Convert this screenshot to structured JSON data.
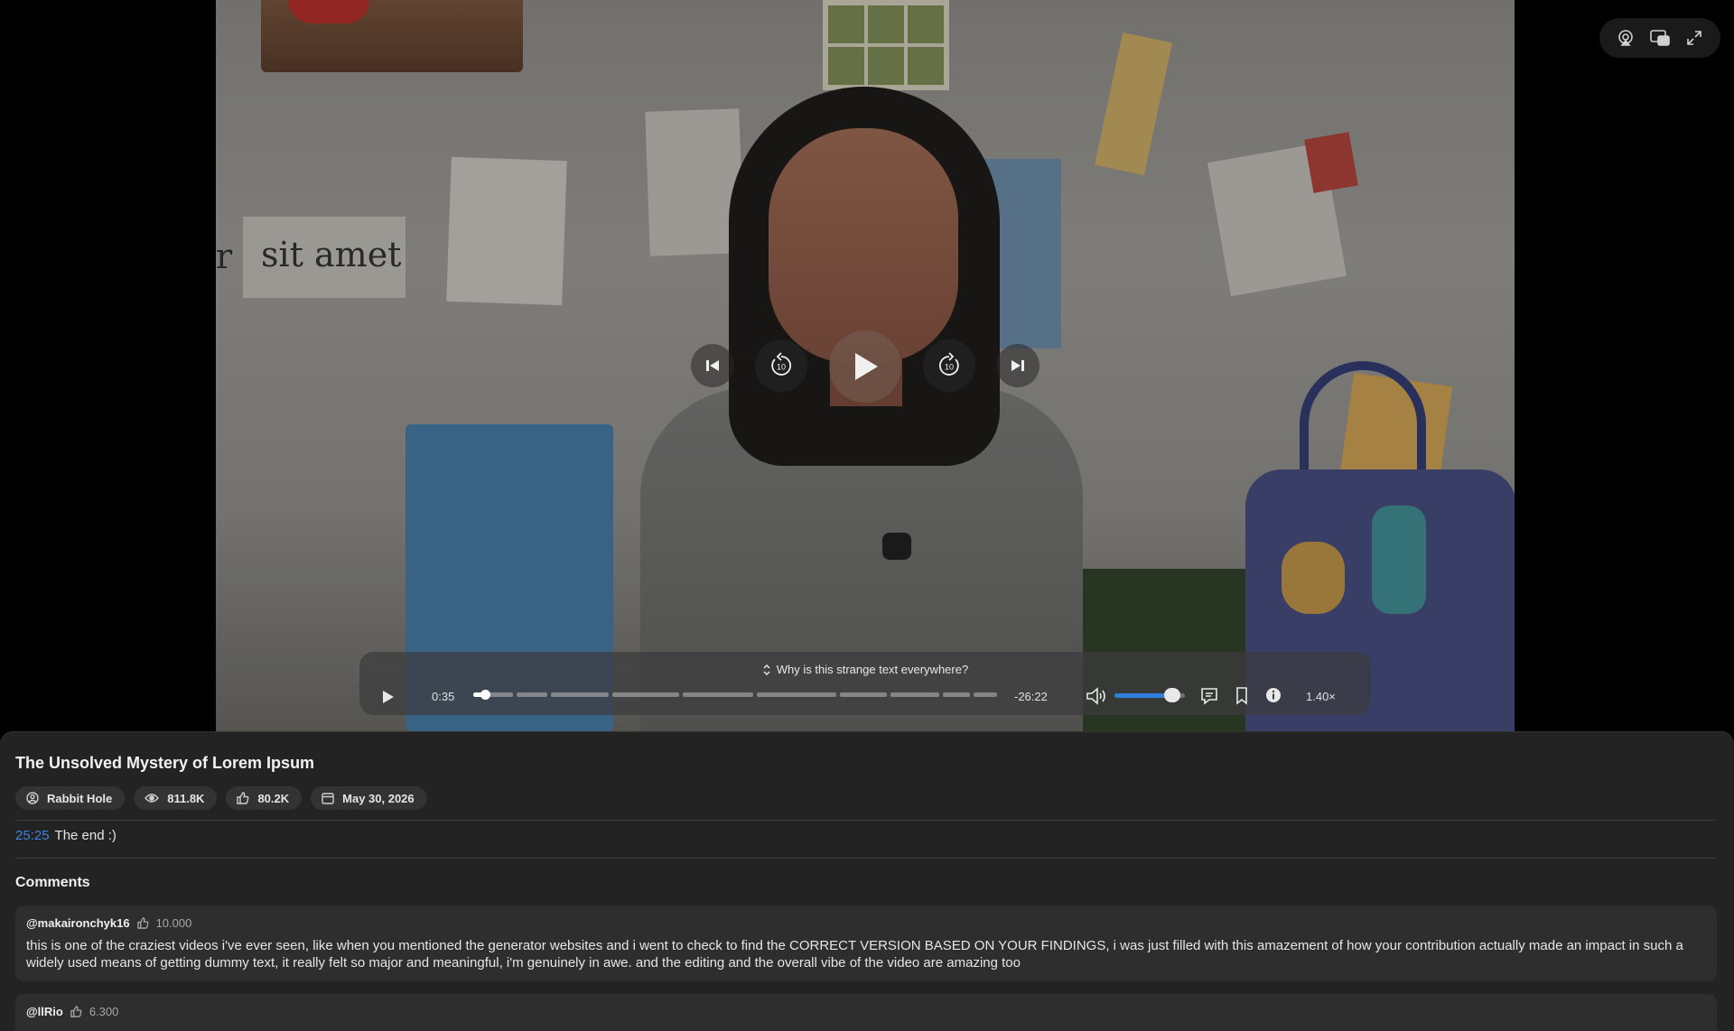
{
  "video": {
    "sign_text": "sit amet",
    "sign_edge": "r"
  },
  "player": {
    "chapter_title": "Why is this strange text everywhere?",
    "time_elapsed": "0:35",
    "time_remaining": "-26:22",
    "speed": "1.40×",
    "progress_fraction": 0.022,
    "volume_fraction": 0.82,
    "icons": {
      "airplay": "airplay-icon",
      "pip": "picture-in-picture-icon",
      "fullscreen": "fullscreen-icon",
      "prev": "skip-previous-icon",
      "back10": "rewind-10-icon",
      "play": "play-icon",
      "fwd10": "forward-10-icon",
      "next": "skip-next-icon",
      "volume": "speaker-icon",
      "captions": "captions-icon",
      "bookmark": "bookmark-icon",
      "info": "info-icon"
    },
    "skip_label": "10"
  },
  "details": {
    "title": "The Unsolved Mystery of Lorem Ipsum",
    "channel": "Rabbit Hole",
    "views": "811.8K",
    "likes": "80.2K",
    "date": "May 30, 2026",
    "chapter_timestamp": "25:25",
    "chapter_text": "The end :)",
    "comments_heading": "Comments",
    "comments": [
      {
        "author": "@makaironchyk16",
        "likes": "10.000",
        "text": "this is one of the craziest videos i've ever seen, like when you mentioned the generator websites and i went to check to find the CORRECT VERSION BASED ON YOUR FINDINGS, i was just filled with this amazement of how your contribution actually made an impact in such a widely used means of getting dummy text, it really felt so major and meaningful, i'm genuinely in awe. and the editing and the overall vibe of the video are amazing too"
      },
      {
        "author": "@llRio",
        "likes": "6.300",
        "text": ""
      }
    ]
  },
  "colors": {
    "accent": "#3d82e0",
    "volume": "#2f7dde",
    "panel": "#232323",
    "card": "#2e2e2e"
  }
}
